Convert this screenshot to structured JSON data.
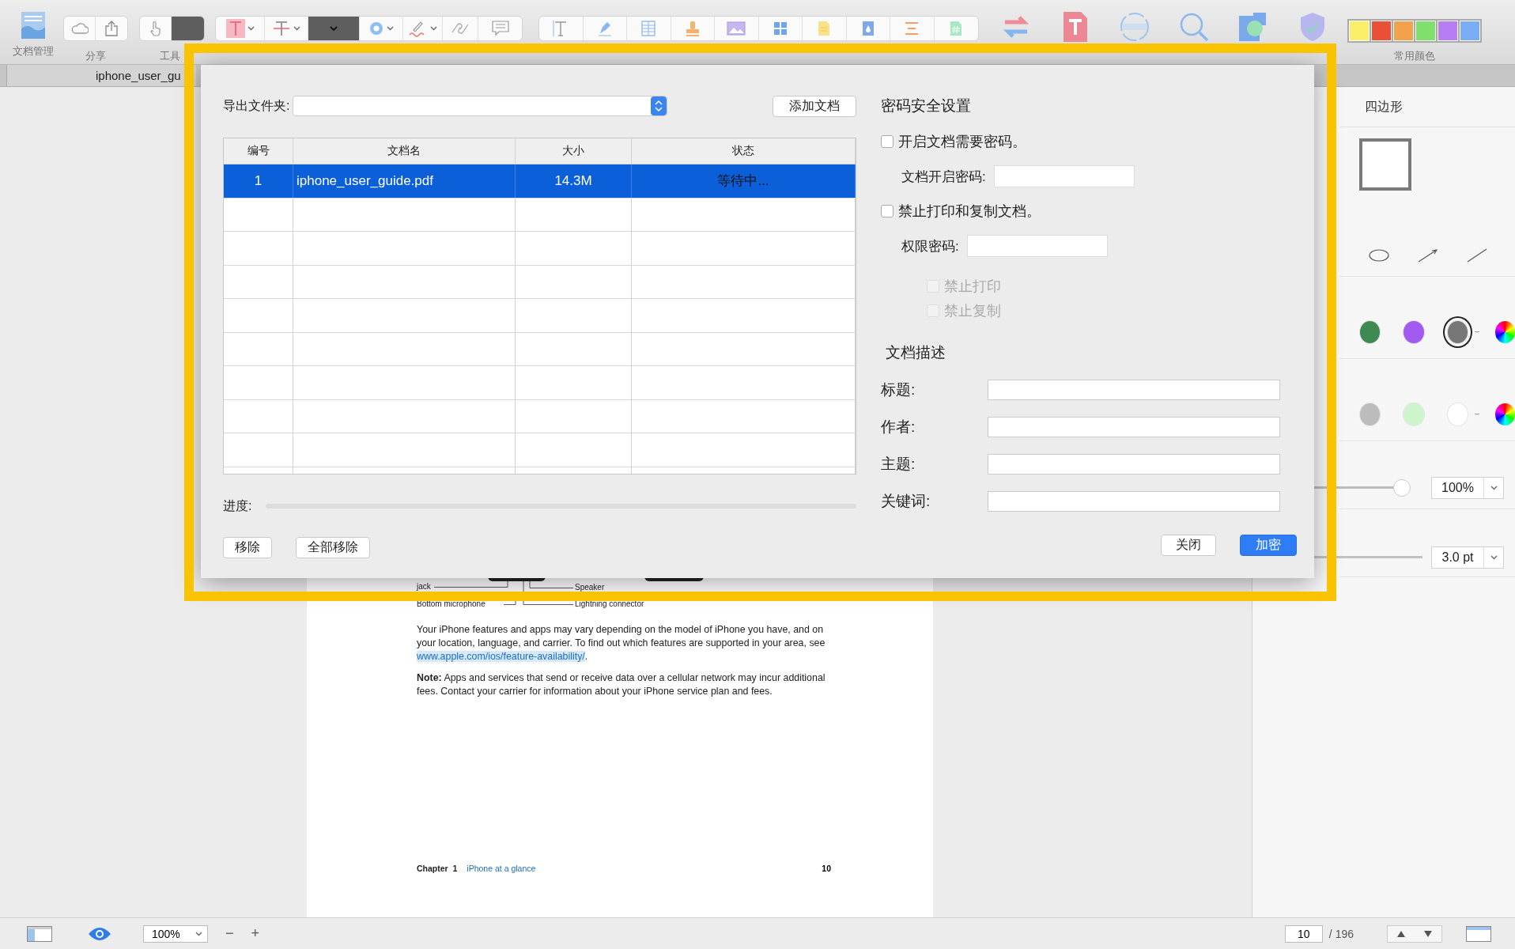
{
  "toolbar": {
    "doc_manager_label": "文档管理",
    "share_label": "分享",
    "tools_label": "工具",
    "colors_label": "常用颜色",
    "swatches": [
      {
        "color": "#fbef6a"
      },
      {
        "color": "#ea5035"
      },
      {
        "color": "#f2a24b"
      },
      {
        "color": "#7fe06c"
      },
      {
        "color": "#b67ef2"
      },
      {
        "color": "#79aef6"
      }
    ]
  },
  "tab": {
    "title": "iphone_user_gu"
  },
  "document": {
    "callouts": [
      "jack",
      "Speaker",
      "Bottom microphone",
      "Lightning connector"
    ],
    "paragraph": "Your iPhone features and apps may vary depending on the model of iPhone you have, and on your location, language, and carrier. To find out which features are supported in your area, see",
    "link": "www.apple.com/ios/feature-availability/",
    "link_end": ".",
    "note": "**Note:**  Apps and services that send or receive data over a cellular network may incur additional fees. Contact your carrier for information about your iPhone service plan and fees.",
    "footer": {
      "chapter": "Chapter  1",
      "chapter_title": "iPhone at a glance",
      "page": "10"
    }
  },
  "dialog": {
    "export_label": "导出文件夹:",
    "add_button": "添加文档",
    "columns": [
      "编号",
      "文档名",
      "大小",
      "状态"
    ],
    "rows": [
      {
        "number": "1",
        "name": "iphone_user_guide.pdf",
        "size": "14.3M",
        "status": "等待中...",
        "selected": true
      }
    ],
    "progress_label": "进度:",
    "progress": {
      "level": 0
    },
    "remove_button": "移除",
    "remove_all_button": "全部移除",
    "security_title": "密码安全设置",
    "options": [
      {
        "kind": "check",
        "label": "开启文档需要密码。",
        "checked": false,
        "disabled": false
      },
      {
        "kind": "field",
        "label": "文档开启密码:"
      },
      {
        "kind": "check",
        "label": "禁止打印和复制文档。",
        "checked": false,
        "disabled": false
      },
      {
        "kind": "field",
        "label": "权限密码:"
      },
      {
        "kind": "subcheck",
        "label": "禁止打印",
        "checked": false,
        "disabled": true
      },
      {
        "kind": "subcheck",
        "label": "禁止复制",
        "checked": false,
        "disabled": true
      }
    ],
    "description_title": "文档描述",
    "fields": [
      {
        "label": "标题:"
      },
      {
        "label": "作者:"
      },
      {
        "label": "主题:"
      },
      {
        "label": "关键词:"
      }
    ],
    "close_button": "关闭",
    "encrypt_button": "加密"
  },
  "shape_panel": {
    "title": "四边形",
    "colors_row_1": [
      {
        "color": "#3e8a52",
        "selected": false
      },
      {
        "color": "#a35af0",
        "selected": false
      },
      {
        "color": "#777777",
        "selected": true
      }
    ],
    "colors_row_2": [
      {
        "color": "#bcbcbc",
        "selected": false
      },
      {
        "color": "#cdf5cd",
        "selected": false
      },
      {
        "color": "#ffffff",
        "selected": false
      }
    ],
    "opacity": {
      "level": 1,
      "value": "100%"
    },
    "line_width": {
      "level": 1,
      "value": "3.0 pt"
    }
  },
  "status_bar": {
    "zoom": "100%",
    "zoom_out": "−",
    "zoom_in": "+",
    "page": "10",
    "page_total": "/ 196"
  }
}
